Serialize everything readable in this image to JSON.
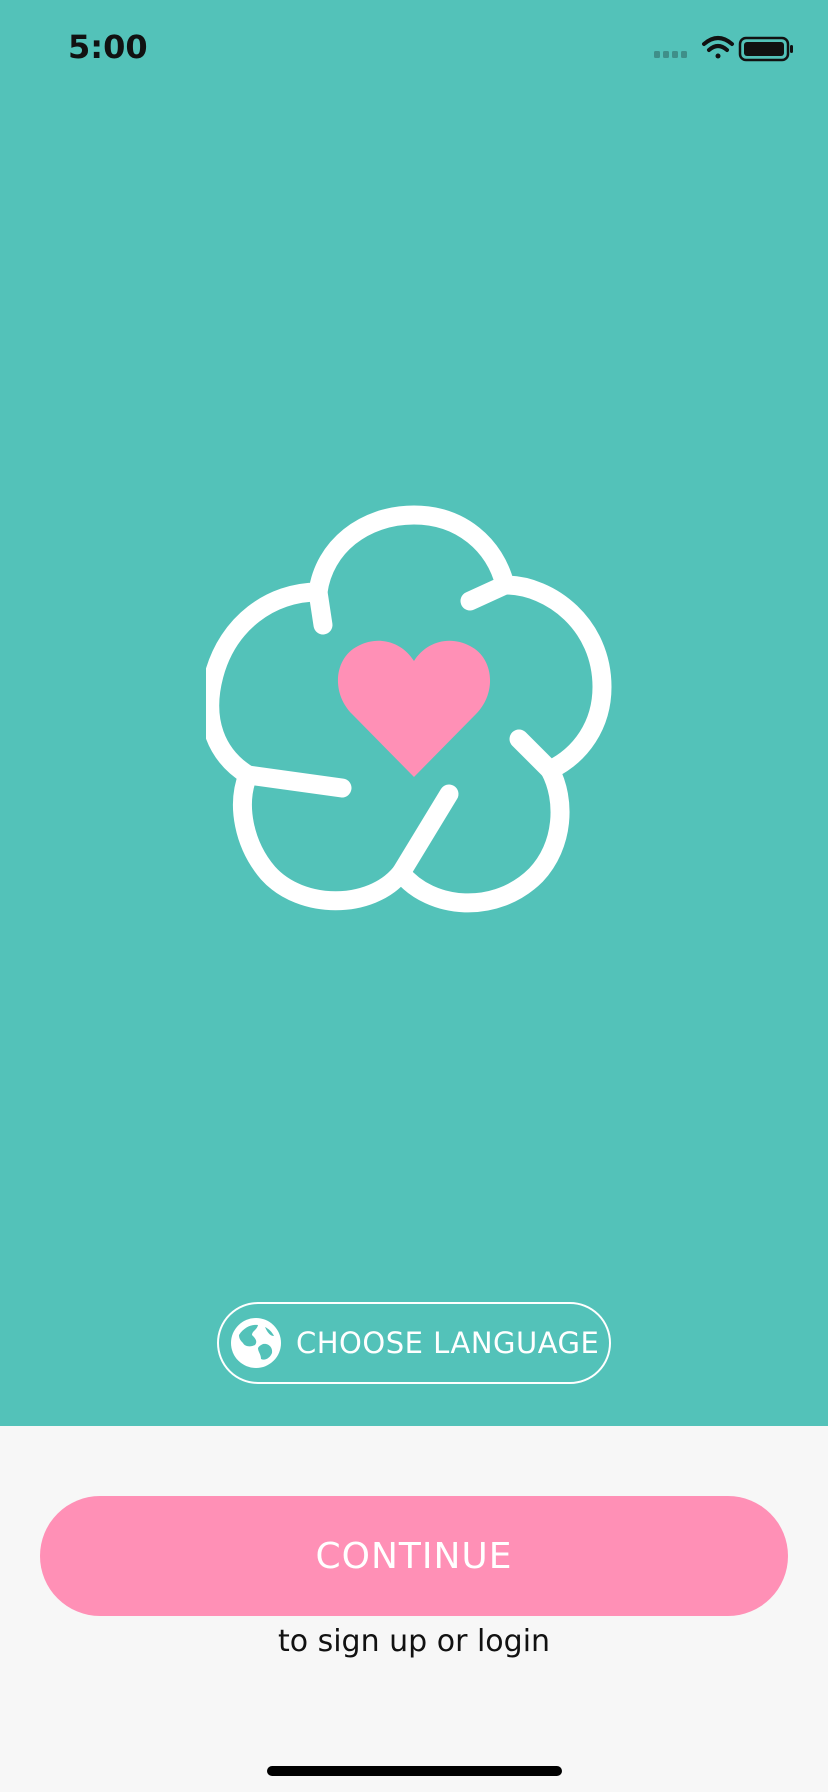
{
  "status_bar": {
    "time": "5:00",
    "icons": [
      "signal-icon",
      "wifi-icon",
      "battery-icon"
    ]
  },
  "logo": {
    "icon": "flower-heart-logo"
  },
  "language_button": {
    "label": "CHOOSE LANGUAGE",
    "icon": "globe-icon"
  },
  "continue_button": {
    "label": "CONTINUE"
  },
  "subtext": "to sign up or login",
  "colors": {
    "hero_bg": "#53c2b9",
    "accent_pink": "#ff90b6",
    "bottom_bg": "#f7f7f7"
  }
}
